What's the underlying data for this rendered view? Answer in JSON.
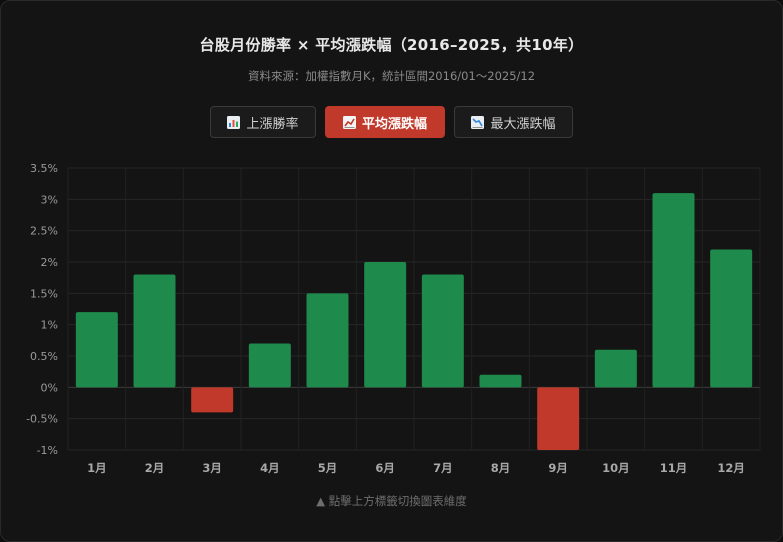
{
  "title": "台股月份勝率 × 平均漲跌幅（2016–2025，共10年）",
  "subtitle": "資料來源：加權指數月K，統計區間2016/01～2025/12",
  "tabs": [
    {
      "label": "上漲勝率",
      "icon": "bar-chart-icon",
      "active": false
    },
    {
      "label": "平均漲跌幅",
      "icon": "chart-trend-icon",
      "active": true
    },
    {
      "label": "最大漲跌幅",
      "icon": "chart-decrease-icon",
      "active": false
    }
  ],
  "hint": "▲ 點擊上方標籤切換圖表維度",
  "colors": {
    "positive": "#1e8a4c",
    "negative": "#c0392b",
    "active_tab": "#c0392b"
  },
  "chart_data": {
    "type": "bar",
    "categories": [
      "1月",
      "2月",
      "3月",
      "4月",
      "5月",
      "6月",
      "7月",
      "8月",
      "9月",
      "10月",
      "11月",
      "12月"
    ],
    "values": [
      1.2,
      1.8,
      -0.4,
      0.7,
      1.5,
      2.0,
      1.8,
      0.2,
      -1.0,
      0.6,
      3.1,
      2.2
    ],
    "y_ticks": [
      "3.5%",
      "3%",
      "2.5%",
      "2%",
      "1.5%",
      "1%",
      "0.5%",
      "0%",
      "-0.5%",
      "-1%"
    ],
    "ylim": [
      -1,
      3.5
    ],
    "grid": true
  }
}
